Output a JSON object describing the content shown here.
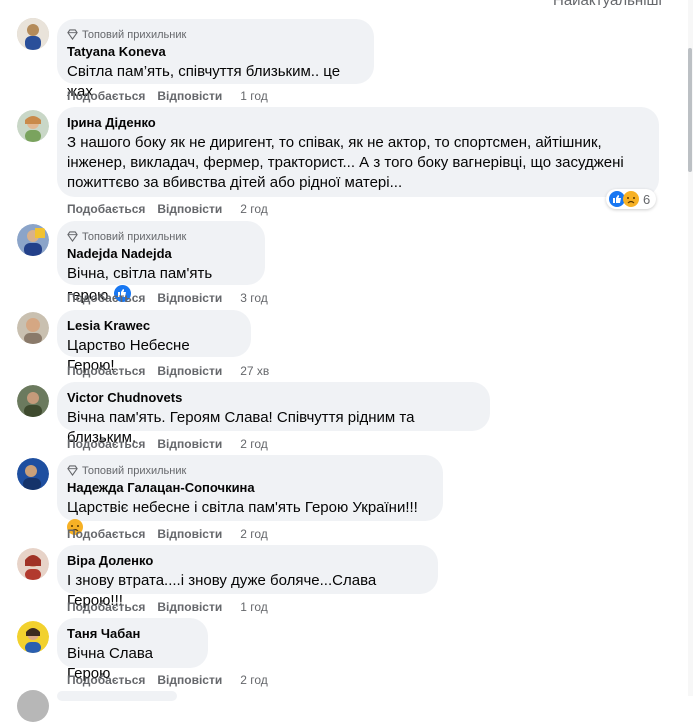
{
  "sort_label": "Найактуальніші",
  "badge_text": "Топовий прихильник",
  "actions": {
    "like": "Подобається",
    "reply": "Відповісти"
  },
  "comments": [
    {
      "author": "Tatyana Koneva",
      "badge": true,
      "text": "Світла пам’ять, співчуття близьким.. це жах",
      "time": "1 год"
    },
    {
      "author": "Ірина Діденко",
      "badge": false,
      "text": "З нашого боку як не диригент, то співак, як не актор, то спортсмен, айтішник, інженер, викладач, фермер, тракторист... А з того боку вагнерівці, що засуджені пожиттєво за вбивства дітей або рідної матері...",
      "time": "2 год",
      "reactions": {
        "icons": [
          "like",
          "sad"
        ],
        "count": "6"
      }
    },
    {
      "author": "Nadejda Nadejda",
      "badge": true,
      "text": "Вічна, світла пам'ять герою",
      "time": "3 год",
      "inline_reaction": "like"
    },
    {
      "author": "Lesia Krawec",
      "badge": false,
      "text": "Царство Небесне Герою!",
      "time": "27 хв"
    },
    {
      "author": "Victor Chudnovets",
      "badge": false,
      "text": "Вічна пам'ять. Героям Слава! Співчуття рідним та близьким.",
      "time": "2 год"
    },
    {
      "author": "Надежда Галацан-Сопочкина",
      "badge": true,
      "text": "Царствіє небесне і світла пам'ять Герою України!!!",
      "time": "2 год",
      "inline_reaction": "sad"
    },
    {
      "author": "Віра Доленко",
      "badge": false,
      "text": "І знову втрата....і знову дуже боляче...Слава Герою!!!",
      "time": "1 год"
    },
    {
      "author": "Таня Чабан",
      "badge": false,
      "text": "Вічна Слава Герою",
      "time": "2 год"
    }
  ],
  "colors": {
    "bubble": "#f0f2f5",
    "meta": "#65676b",
    "like_blue": "#1877f2",
    "sad_yellow": "#f7b125"
  }
}
